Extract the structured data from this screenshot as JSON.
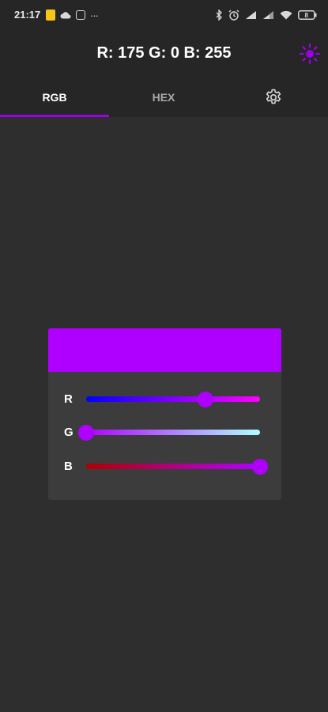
{
  "status_bar": {
    "time": "21:17",
    "notification_icons": [
      "notes-icon",
      "cloud-icon",
      "sim-icon",
      "more-dots-icon"
    ],
    "more_dots": "···",
    "system_icons": [
      "bluetooth-icon",
      "alarm-icon",
      "signal-icon",
      "signal-icon",
      "wifi-icon",
      "battery-icon"
    ],
    "battery_level": "8"
  },
  "app_bar": {
    "title": "R: 175 G: 0 B: 255",
    "theme_icon": "sun-icon"
  },
  "tabs": [
    {
      "label": "RGB",
      "selected": true
    },
    {
      "label": "HEX",
      "selected": false
    },
    {
      "icon": "gear-icon",
      "selected": false
    }
  ],
  "color": {
    "r": 175,
    "g": 0,
    "b": 255,
    "preview_hex": "#AF00FF"
  },
  "sliders": [
    {
      "label": "R",
      "value": 175,
      "max": 255
    },
    {
      "label": "G",
      "value": 0,
      "max": 255
    },
    {
      "label": "B",
      "value": 255,
      "max": 255
    }
  ],
  "colors": {
    "accent": "#9B00E8",
    "background": "#2E2E2E",
    "bar": "#262626",
    "card": "#3C3C3C"
  }
}
